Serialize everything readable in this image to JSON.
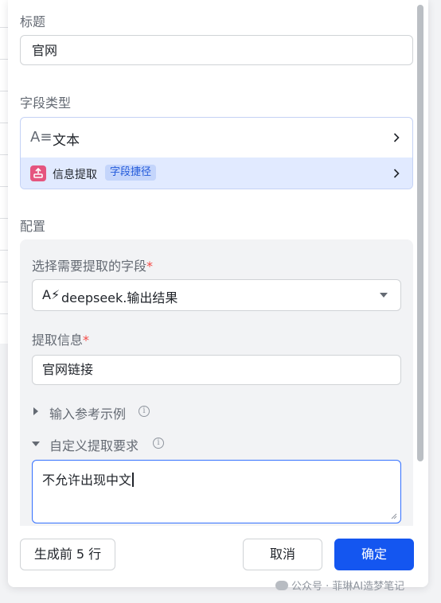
{
  "form": {
    "title_label": "标题",
    "title_value": "官网",
    "field_type_label": "字段类型",
    "field_type": {
      "text_icon": "A≡",
      "text_label": "文本",
      "extract_label": "信息提取",
      "extract_tag": "字段捷径"
    },
    "config_label": "配置",
    "config": {
      "source_label": "选择需要提取的字段",
      "required_mark": "*",
      "source_value": "deepseek.输出结果",
      "source_icon": "A⚡",
      "extract_info_label": "提取信息",
      "extract_info_value": "官网链接",
      "examples_label": "输入参考示例",
      "custom_label": "自定义提取要求",
      "custom_value": "不允许出现中文",
      "info_glyph": "i"
    }
  },
  "footer": {
    "generate_label": "生成前 5 行",
    "cancel_label": "取消",
    "confirm_label": "确定"
  },
  "watermark": "公众号 · 菲琳AI造梦笔记",
  "colors": {
    "primary": "#1456f0",
    "required": "#f54a45",
    "extract_icon": "#e5557f",
    "selected_bg": "#e1eaff"
  },
  "icons": [
    "text-type-icon",
    "chevron-right-icon",
    "extract-icon",
    "caret-down-icon",
    "info-icon",
    "triangle-right-icon",
    "triangle-down-icon",
    "resize-handle-icon",
    "wechat-icon"
  ]
}
